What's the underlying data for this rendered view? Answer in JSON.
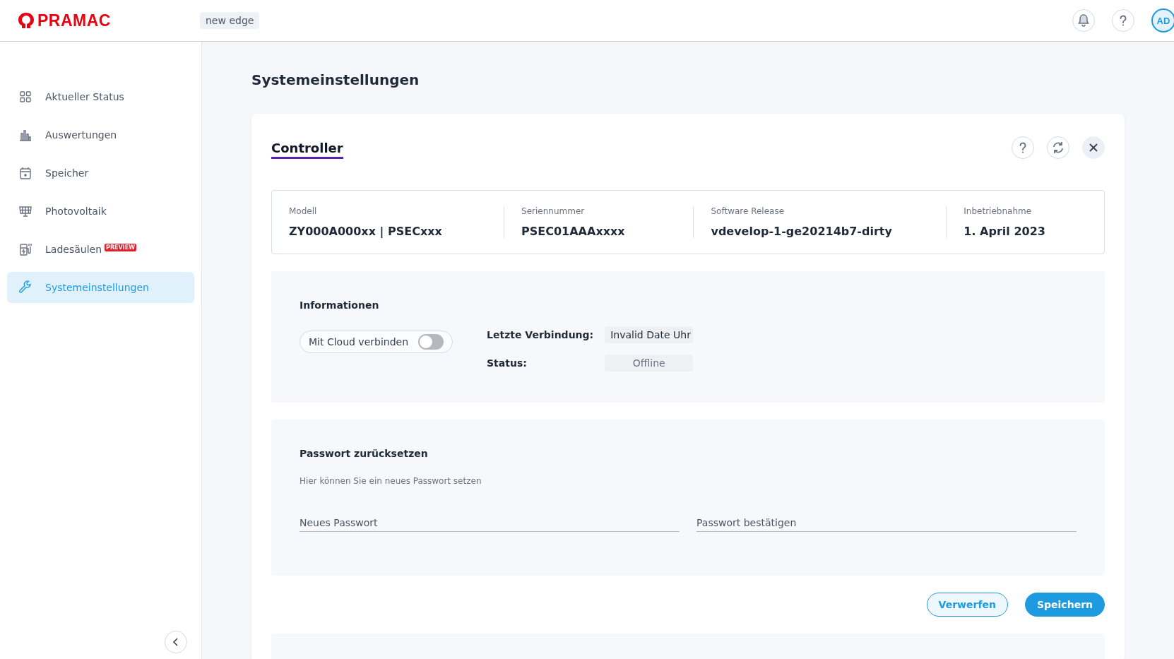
{
  "header": {
    "logo": "PRAMAC",
    "environment": "new edge",
    "avatar": "AD"
  },
  "sidebar": {
    "items": [
      {
        "label": "Aktueller Status",
        "selected": false
      },
      {
        "label": "Auswertungen",
        "selected": false
      },
      {
        "label": "Speicher",
        "selected": false
      },
      {
        "label": "Photovoltaik",
        "selected": false
      },
      {
        "label": "Ladesäulen",
        "selected": false,
        "badge": "PREVIEW"
      },
      {
        "label": "Systemeinstellungen",
        "selected": true
      }
    ]
  },
  "page": {
    "title": "Systemeinstellungen"
  },
  "card": {
    "tabs": [
      {
        "label": "Controller",
        "selected": true
      }
    ],
    "details": [
      {
        "label": "Modell",
        "value": "ZY000A000xx | PSECxxx"
      },
      {
        "label": "Seriennummer",
        "value": "PSEC01AAAxxxx"
      },
      {
        "label": "Software Release",
        "value": "vdevelop-1-ge20214b7-dirty"
      },
      {
        "label": "Inbetriebnahme",
        "value": "1. April 2023"
      }
    ],
    "info": {
      "title": "Informationen",
      "cloud_toggle": {
        "label": "Mit Cloud verbinden",
        "on": false
      },
      "last_connection": {
        "label": "Letzte Verbindung:",
        "value": "Invalid Date Uhr"
      },
      "status": {
        "label": "Status:",
        "value": "Offline"
      }
    },
    "password": {
      "title": "Passwort zurücksetzen",
      "hint": "Hier können Sie ein neues Passwort setzen",
      "fields": [
        {
          "placeholder": "Neues Passwort"
        },
        {
          "placeholder": "Passwort bestätigen"
        }
      ]
    },
    "buttons": [
      {
        "label": "Verwerfen",
        "kind": "secondary"
      },
      {
        "label": "Speichern",
        "kind": "primary"
      }
    ]
  }
}
